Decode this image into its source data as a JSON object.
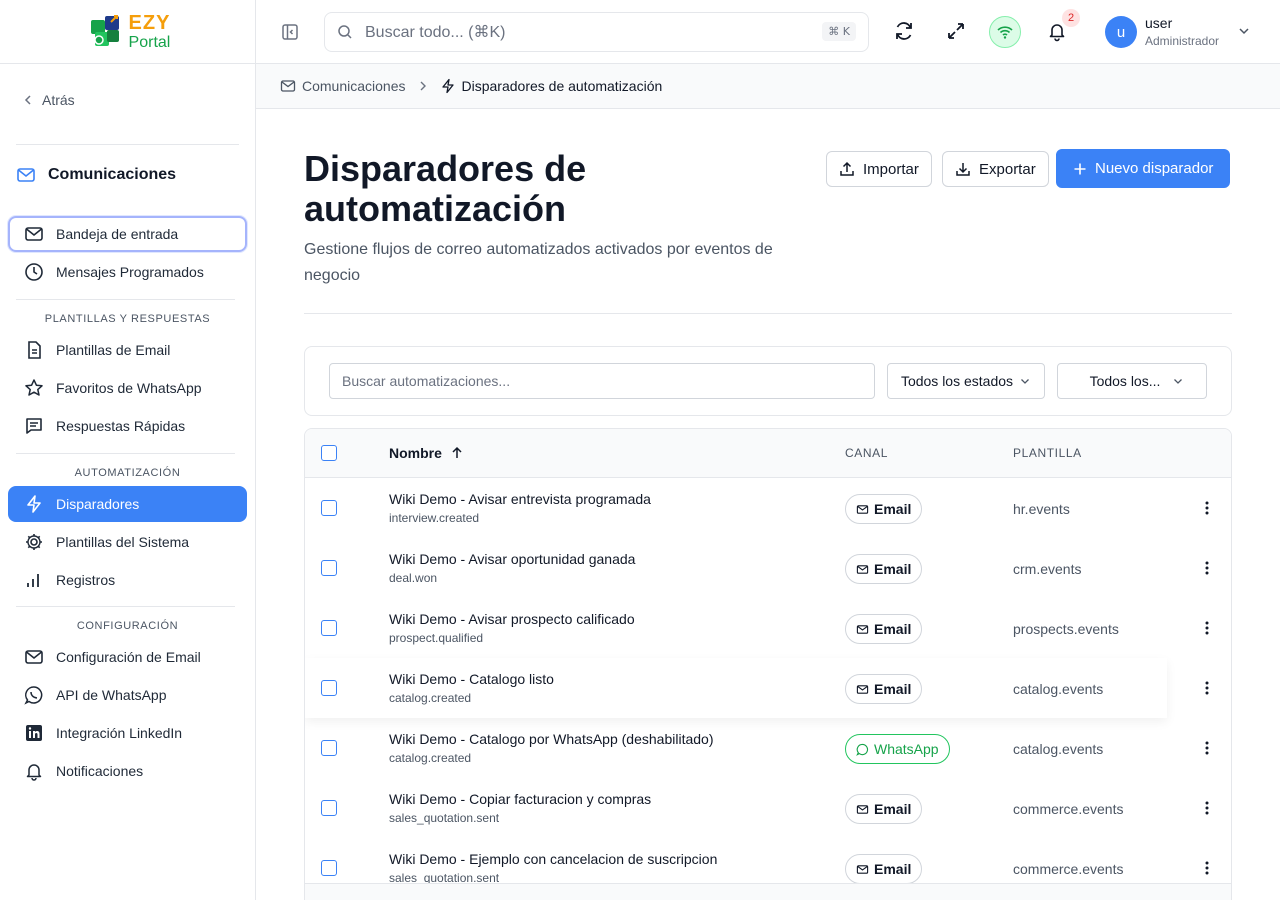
{
  "brand": {
    "line1": "EZY",
    "line2": "Portal"
  },
  "sidebar": {
    "back_label": "Atrás",
    "section_title": "Comunicaciones",
    "items_top": [
      {
        "label": "Bandeja de entrada",
        "icon": "mail-icon"
      },
      {
        "label": "Mensajes Programados",
        "icon": "clock-icon"
      }
    ],
    "group_templates": {
      "label": "PLANTILLAS Y RESPUESTAS",
      "items": [
        {
          "label": "Plantillas de Email",
          "icon": "document-icon"
        },
        {
          "label": "Favoritos de WhatsApp",
          "icon": "star-icon"
        },
        {
          "label": "Respuestas Rápidas",
          "icon": "chat-icon"
        }
      ]
    },
    "group_automation": {
      "label": "AUTOMATIZACIÓN",
      "items": [
        {
          "label": "Disparadores",
          "icon": "bolt-icon"
        },
        {
          "label": "Plantillas del Sistema",
          "icon": "gear-icon"
        },
        {
          "label": "Registros",
          "icon": "bar-chart-icon"
        }
      ]
    },
    "group_config": {
      "label": "CONFIGURACIÓN",
      "items": [
        {
          "label": "Configuración de Email",
          "icon": "mail-icon"
        },
        {
          "label": "API de WhatsApp",
          "icon": "whatsapp-icon"
        },
        {
          "label": "Integración LinkedIn",
          "icon": "linkedin-icon"
        },
        {
          "label": "Notificaciones",
          "icon": "bell-icon"
        }
      ]
    }
  },
  "topbar": {
    "search_placeholder": "Buscar todo... (⌘K)",
    "search_shortcut": "⌘ K",
    "notifications_count": "2",
    "user": {
      "initial": "u",
      "name": "user",
      "role": "Administrador"
    }
  },
  "breadcrumb": {
    "parent": "Comunicaciones",
    "current": "Disparadores de automatización"
  },
  "page": {
    "title": "Disparadores de automatización",
    "subtitle": "Gestione flujos de correo automatizados activados por eventos de negocio",
    "import_label": "Importar",
    "export_label": "Exportar",
    "new_label": "Nuevo disparador"
  },
  "filters": {
    "search_placeholder": "Buscar automatizaciones...",
    "status_select": "Todos los estados",
    "channel_select": "Todos los..."
  },
  "table": {
    "columns": {
      "name": "Nombre",
      "channel": "CANAL",
      "template": "PLANTILLA"
    },
    "rows": [
      {
        "name": "Wiki Demo - Avisar entrevista programada",
        "event": "interview.created",
        "channel": "Email",
        "template": "hr.events"
      },
      {
        "name": "Wiki Demo - Avisar oportunidad ganada",
        "event": "deal.won",
        "channel": "Email",
        "template": "crm.events"
      },
      {
        "name": "Wiki Demo - Avisar prospecto calificado",
        "event": "prospect.qualified",
        "channel": "Email",
        "template": "prospects.events"
      },
      {
        "name": "Wiki Demo - Catalogo listo",
        "event": "catalog.created",
        "channel": "Email",
        "template": "catalog.events"
      },
      {
        "name": "Wiki Demo - Catalogo por WhatsApp (deshabilitado)",
        "event": "catalog.created",
        "channel": "WhatsApp",
        "template": "catalog.events"
      },
      {
        "name": "Wiki Demo - Copiar facturacion y compras",
        "event": "sales_quotation.sent",
        "channel": "Email",
        "template": "commerce.events"
      },
      {
        "name": "Wiki Demo - Ejemplo con cancelacion de suscripcion",
        "event": "sales_quotation.sent",
        "channel": "Email",
        "template": "commerce.events"
      }
    ]
  }
}
